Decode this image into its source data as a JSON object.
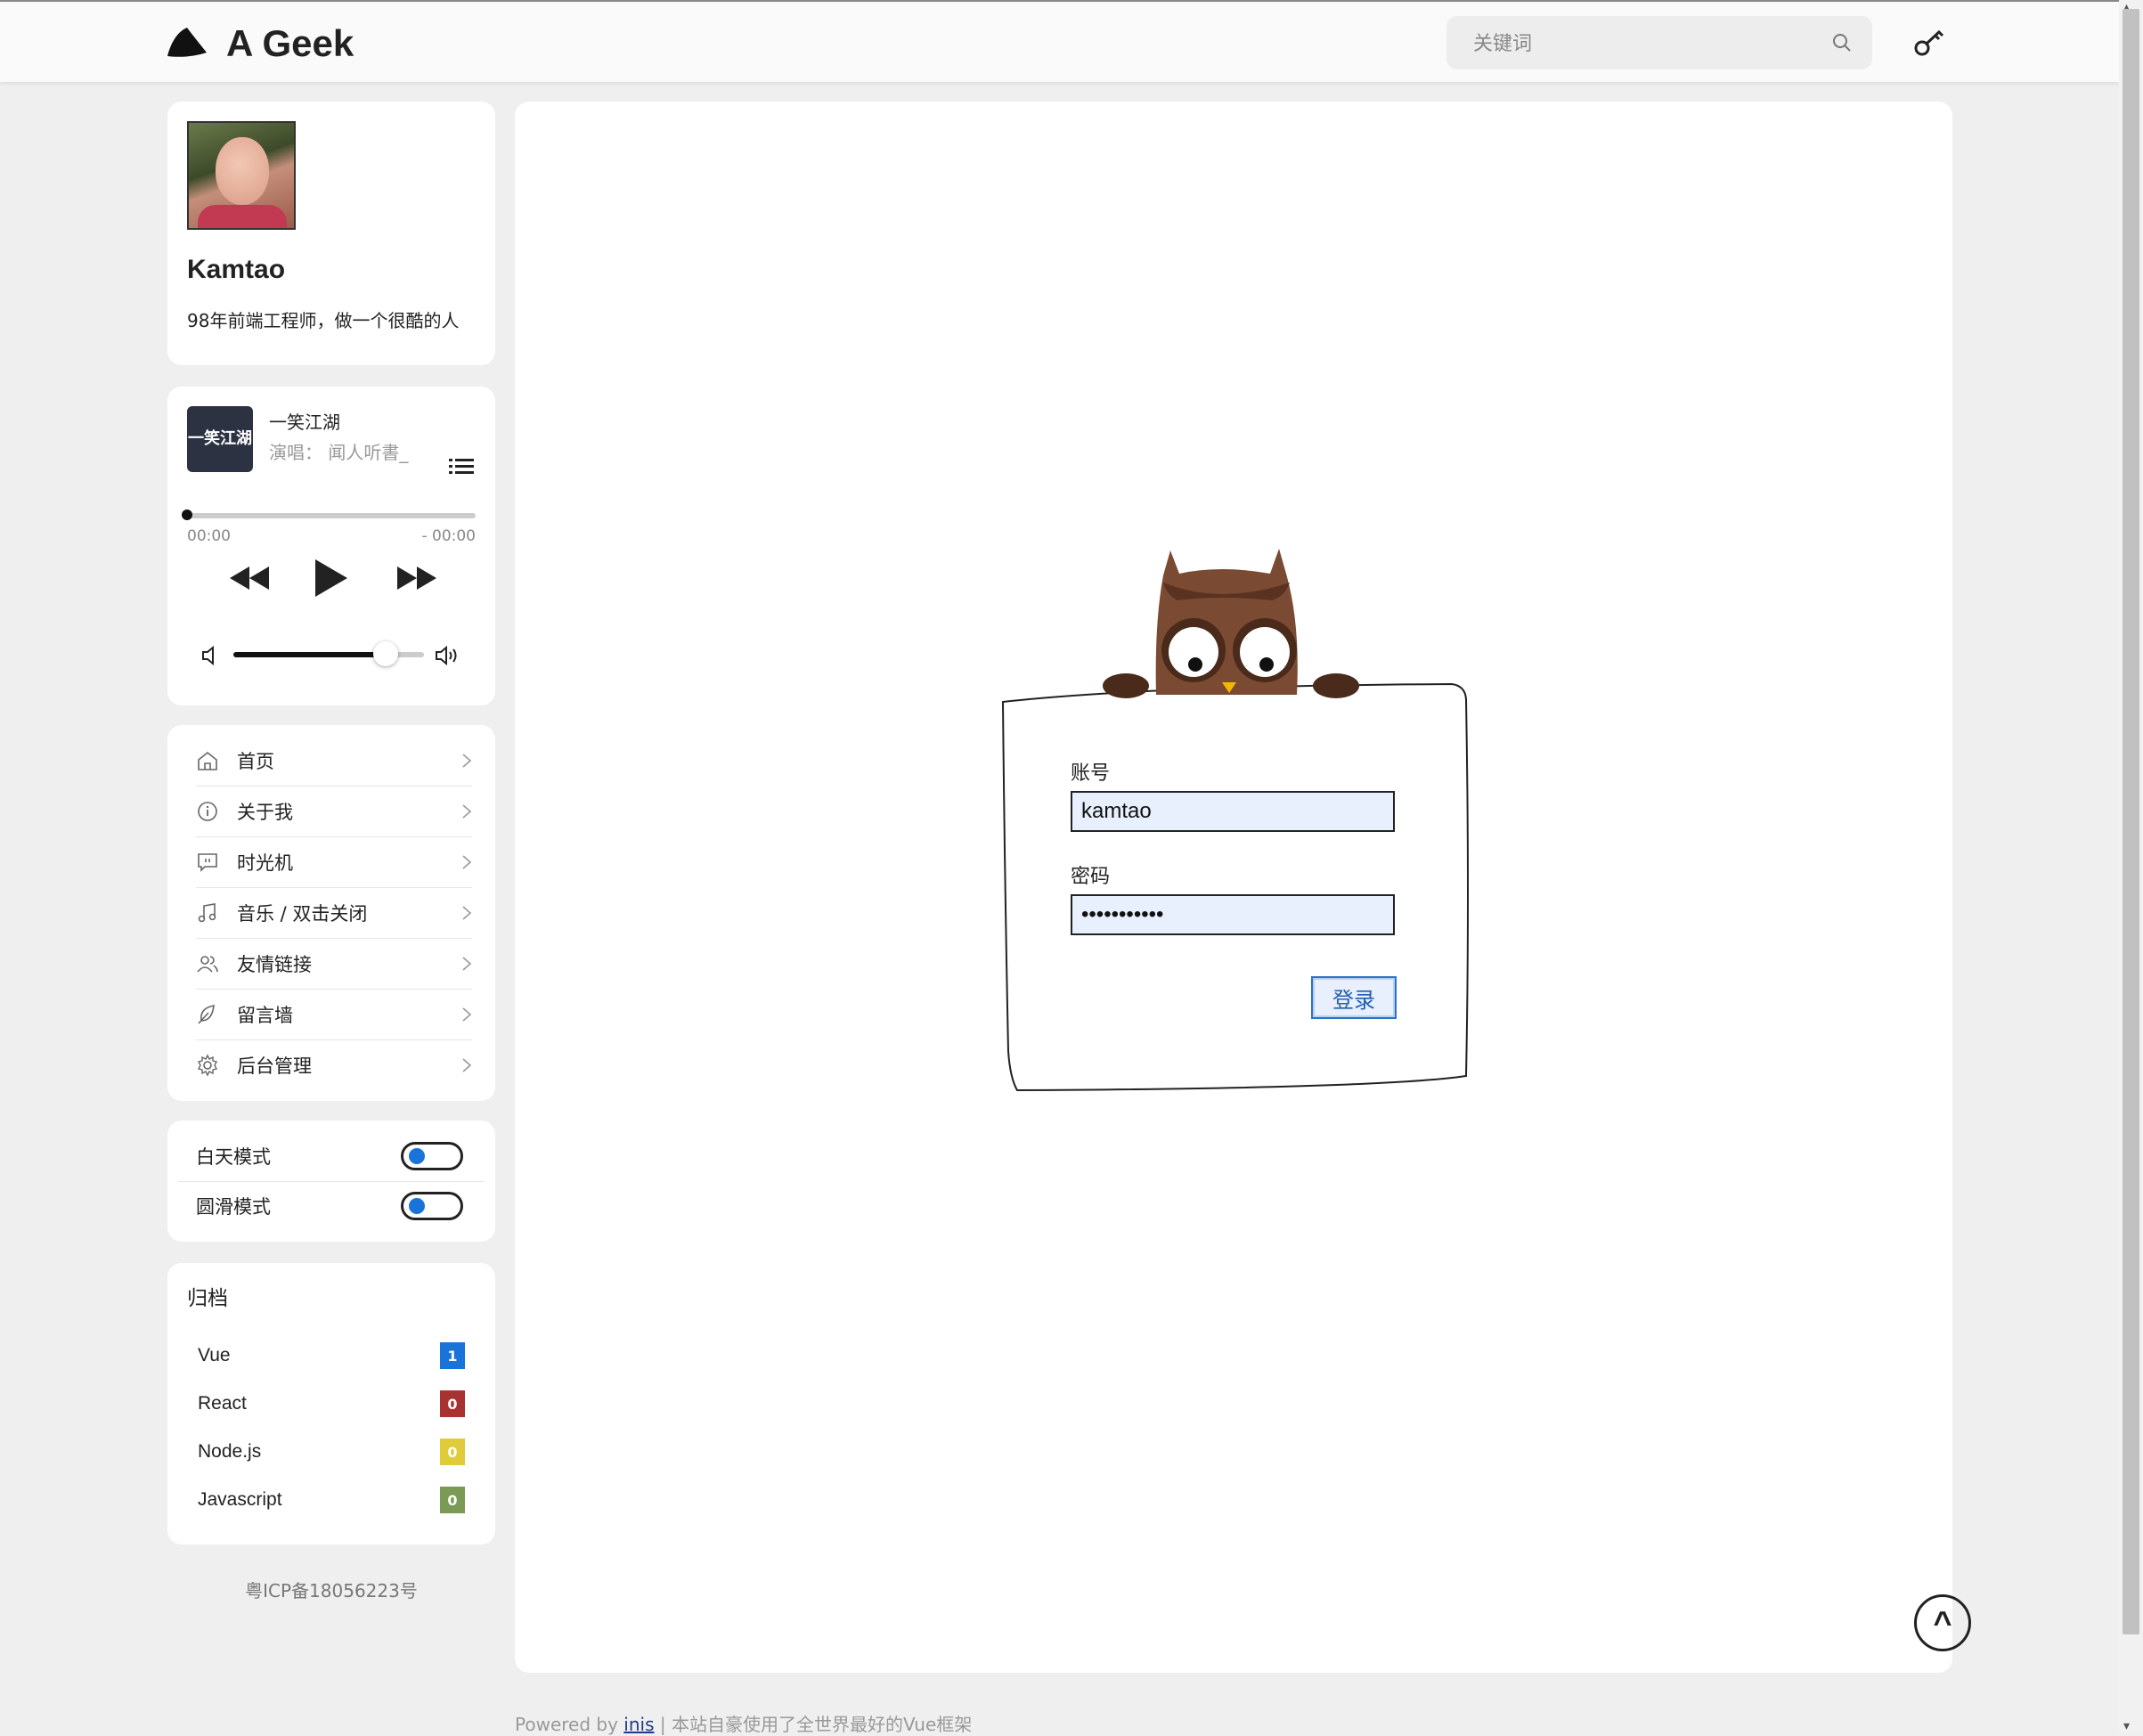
{
  "header": {
    "site_title": "A Geek",
    "search_placeholder": "关键词"
  },
  "profile": {
    "name": "Kamtao",
    "bio": "98年前端工程师，做一个很酷的人"
  },
  "player": {
    "cover_text": "一笑江湖",
    "song_title": "一笑江湖",
    "artist_line": "演唱：  闻人听書_",
    "time_elapsed": "00:00",
    "time_remaining": "- 00:00",
    "progress_fraction": 0.0,
    "volume_fraction": 0.8
  },
  "nav": {
    "items": [
      {
        "label": "首页",
        "icon": "home-icon"
      },
      {
        "label": "关于我",
        "icon": "info-icon"
      },
      {
        "label": "时光机",
        "icon": "message-icon"
      },
      {
        "label": "音乐 / 双击关闭",
        "icon": "music-icon"
      },
      {
        "label": "友情链接",
        "icon": "users-icon"
      },
      {
        "label": "留言墙",
        "icon": "feather-icon"
      },
      {
        "label": "后台管理",
        "icon": "gear-icon"
      }
    ]
  },
  "modes": {
    "day_mode": "白天模式",
    "smooth_mode": "圆滑模式"
  },
  "archive": {
    "heading": "归档",
    "items": [
      {
        "label": "Vue",
        "count": "1",
        "color": "#1a73d9"
      },
      {
        "label": "React",
        "count": "0",
        "color": "#a83232"
      },
      {
        "label": "Node.js",
        "count": "0",
        "color": "#e0cc3a"
      },
      {
        "label": "Javascript",
        "count": "0",
        "color": "#7a9a56"
      }
    ]
  },
  "icp": "粤ICP备18056223号",
  "login": {
    "account_label": "账号",
    "account_value": "kamtao",
    "password_label": "密码",
    "password_value": "•••••••••••",
    "submit_label": "登录"
  },
  "back_to_top": "^",
  "footer": {
    "prefix": "Powered by ",
    "link": "inis",
    "suffix": " | 本站自豪使用了全世界最好的Vue框架"
  }
}
